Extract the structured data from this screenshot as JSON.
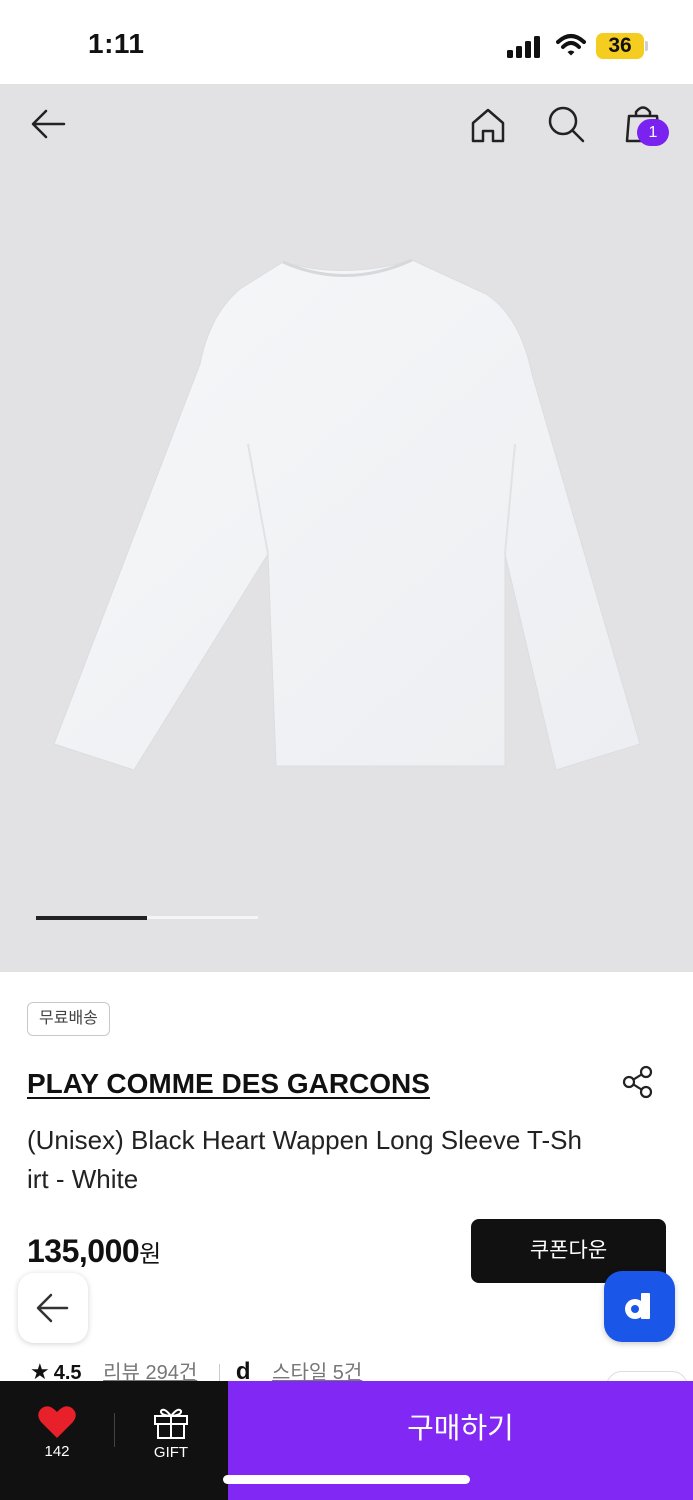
{
  "status_bar": {
    "time": "1:11",
    "battery": "36"
  },
  "header": {
    "back_icon": "arrow-left-icon",
    "home_icon": "home-icon",
    "search_icon": "search-icon",
    "cart_icon": "shopping-bag-icon",
    "cart_count": "1"
  },
  "gallery": {
    "current_image_fraction": 0.5
  },
  "product": {
    "badge": "무료배송",
    "brand": "PLAY COMME DES GARCONS",
    "title": "(Unisex) Black Heart Wappen Long Sleeve T-Shirt - White",
    "price": "135,000",
    "price_unit": "원",
    "coupon_label": "쿠폰다운"
  },
  "rating": {
    "score": "4.5",
    "review_link": "리뷰 294건",
    "style_link": "스타일 5건"
  },
  "bottom_bar": {
    "wish_count": "142",
    "gift_label": "GIFT",
    "buy_label": "구매하기"
  },
  "colors": {
    "accent": "#8128f5",
    "badge": "#7a22f0",
    "floating_d": "#1a56e8",
    "wish_heart": "#e8202a"
  }
}
